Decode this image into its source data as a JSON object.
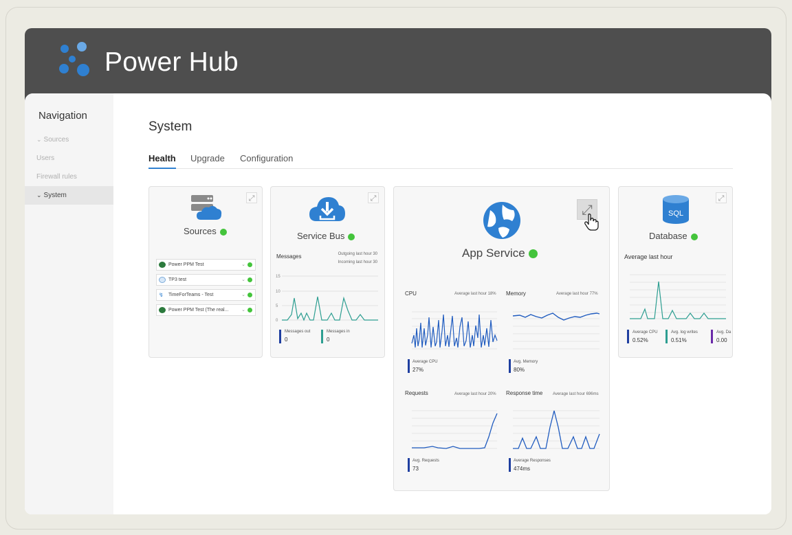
{
  "app": {
    "name": "Power Hub",
    "accent": "#2f80d1",
    "header_color": "#4e4e4e",
    "status_ok": "#44c43c"
  },
  "navigation": {
    "title": "Navigation",
    "items": [
      {
        "label": "Sources",
        "chevron": "⌄"
      },
      {
        "label": "Users"
      },
      {
        "label": "Firewall rules"
      },
      {
        "label": "System",
        "chevron": "⌄",
        "active": true
      }
    ]
  },
  "page": {
    "title": "System"
  },
  "tabs": [
    {
      "label": "Health",
      "active": true
    },
    {
      "label": "Upgrade"
    },
    {
      "label": "Configuration"
    }
  ],
  "cards": {
    "sources": {
      "title": "Sources",
      "icon": "server-cloud-icon",
      "items": [
        {
          "label": "Power PPM Test",
          "icon": "ppm-icon"
        },
        {
          "label": "TP3 test",
          "icon": "tp-icon"
        },
        {
          "label": "TimeForTeams - Test",
          "icon": "tft-icon"
        },
        {
          "label": "Power PPM Test (The real...",
          "icon": "ppm-icon"
        }
      ]
    },
    "service_bus": {
      "title": "Service Bus",
      "icon": "cloud-download-icon",
      "messages_label": "Messages",
      "outgoing": "Outgoing last hour 30",
      "incoming": "Incoming last hour 30",
      "y_ticks": [
        "15",
        "10",
        "5",
        "0"
      ],
      "metrics": [
        {
          "label": "Messages out",
          "value": "0",
          "color": "#1f3fa0"
        },
        {
          "label": "Messages in",
          "value": "0",
          "color": "#2d9e91"
        }
      ]
    },
    "app_service": {
      "title": "App Service",
      "icon": "globe-icon",
      "cpu": {
        "label": "CPU",
        "avg": "Average last hour 18%",
        "metric_label": "Average CPU",
        "metric_value": "27%"
      },
      "memory": {
        "label": "Memory",
        "avg": "Average last hour 77%",
        "metric_label": "Avg. Memory",
        "metric_value": "80%"
      },
      "requests": {
        "label": "Requests",
        "avg": "Average last hour 20%",
        "metric_label": "Avg. Requests",
        "metric_value": "73"
      },
      "response": {
        "label": "Response time",
        "avg": "Average last hour 696ms",
        "metric_label": "Average Responses",
        "metric_value": "474ms"
      }
    },
    "database": {
      "title": "Database",
      "icon": "sql-database-icon",
      "icon_text": "SQL",
      "subtitle": "Average last hour",
      "metrics": [
        {
          "label": "Average CPU",
          "value": "0.52%",
          "color": "#1f3fa0"
        },
        {
          "label": "Avg. log writes",
          "value": "0.51%",
          "color": "#2d9e91"
        },
        {
          "label": "Avg. Da",
          "value": "0.00",
          "color": "#6a2aa8"
        }
      ]
    }
  }
}
